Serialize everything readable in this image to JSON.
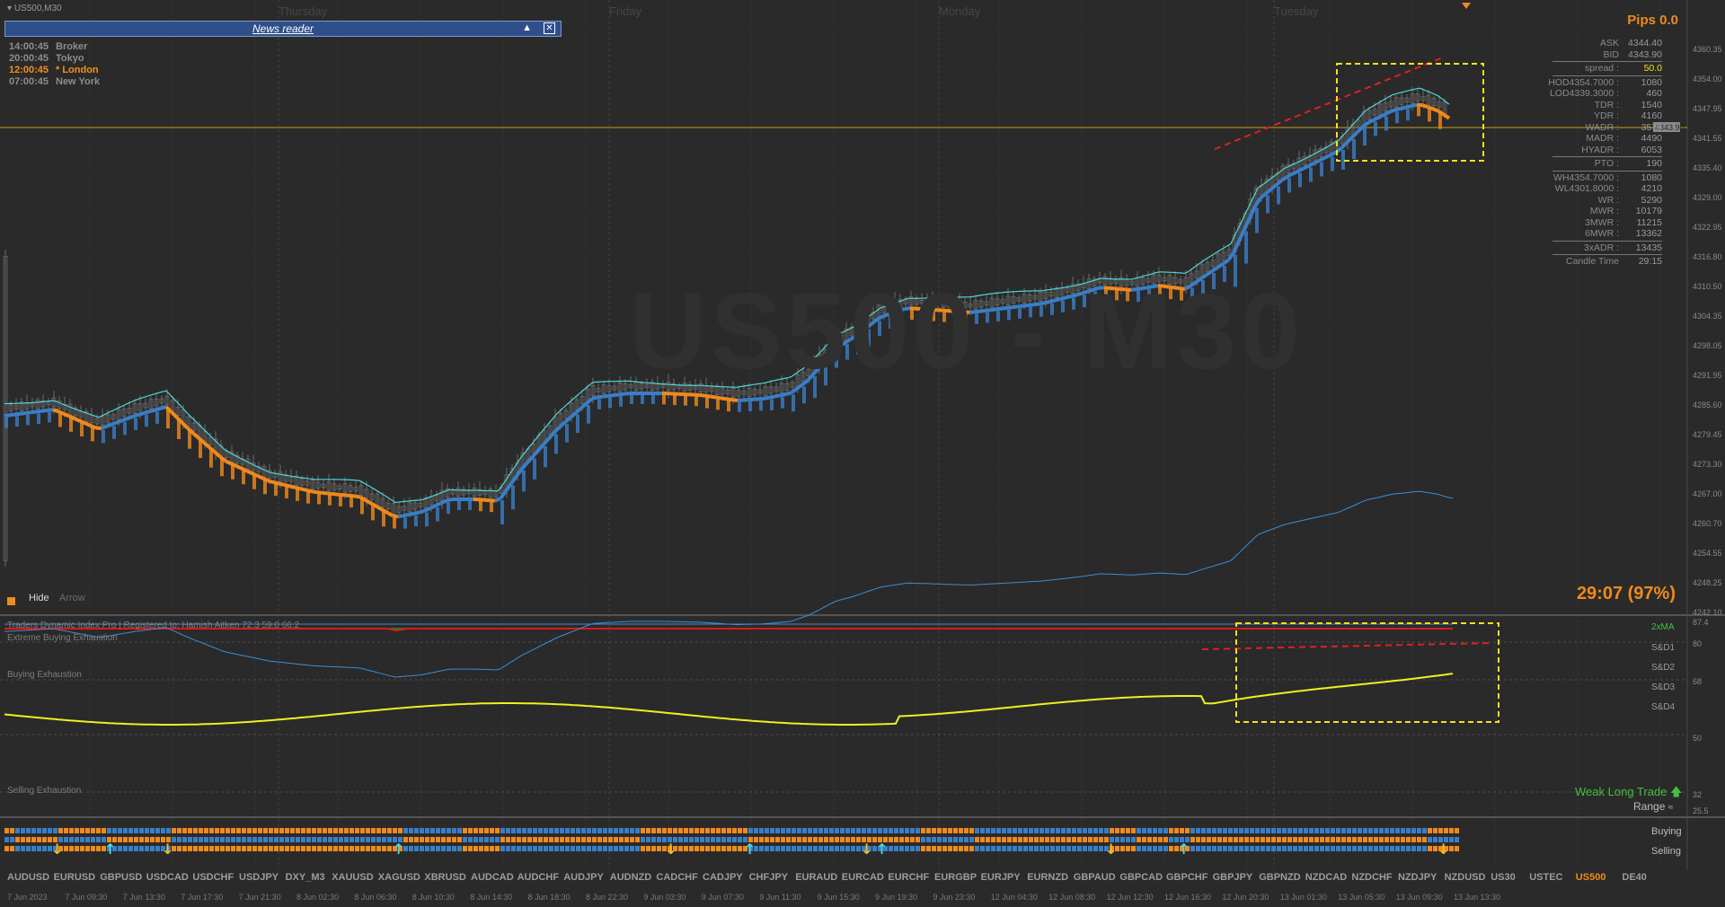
{
  "window": {
    "title": "US500,M30"
  },
  "news_reader": {
    "title": "News reader",
    "collapse_glyph": "▲",
    "close_glyph": "✕"
  },
  "sessions": [
    {
      "time": "14:00:45",
      "name": "Broker",
      "active": false
    },
    {
      "time": "20:00:45",
      "name": "Tokyo",
      "active": false
    },
    {
      "time": "12:00:45",
      "name": "* London",
      "active": true
    },
    {
      "time": "07:00:45",
      "name": "New York",
      "active": false
    }
  ],
  "days": [
    "Thursday",
    "Friday",
    "Monday",
    "Tuesday"
  ],
  "watermark": "US500 - M30",
  "pips": "Pips 0.0",
  "info_panel": [
    {
      "k": "ASK",
      "v": "4344.40"
    },
    {
      "k": "BID",
      "v": "4343.90"
    },
    {
      "sep": true
    },
    {
      "k": "spread :",
      "v": "50.0",
      "hl": true
    },
    {
      "sep": true
    },
    {
      "k": "HOD4354.7000 :",
      "v": "1080"
    },
    {
      "k": "LOD4339.3000 :",
      "v": "460"
    },
    {
      "k": "TDR :",
      "v": "1540"
    },
    {
      "k": "YDR :",
      "v": "4160"
    },
    {
      "k": "WADR :",
      "v": "3576"
    },
    {
      "k": "MADR :",
      "v": "4490"
    },
    {
      "k": "HYADR :",
      "v": "6053"
    },
    {
      "sep": true
    },
    {
      "k": "PTO :",
      "v": "190"
    },
    {
      "sep": true
    },
    {
      "k": "WH4354.7000 :",
      "v": "1080"
    },
    {
      "k": "WL4301.8000 :",
      "v": "4210"
    },
    {
      "k": "WR :",
      "v": "5290"
    },
    {
      "k": "MWR :",
      "v": "10179"
    },
    {
      "k": "3MWR :",
      "v": "11215"
    },
    {
      "k": "6MWR :",
      "v": "13362"
    },
    {
      "sep": true
    },
    {
      "k": "3xADR :",
      "v": "13435"
    },
    {
      "sep": true
    },
    {
      "k": "Candle Time",
      "v": "29:15"
    }
  ],
  "price_axis": [
    "4360.35",
    "4354.00",
    "4347.95",
    "4341.55",
    "4335.40",
    "4329.00",
    "4322.95",
    "4316.80",
    "4310.50",
    "4304.35",
    "4298.05",
    "4291.95",
    "4285.60",
    "4279.45",
    "4273.30",
    "4267.00",
    "4260.70",
    "4254.55",
    "4248.25",
    "4242.10"
  ],
  "current_price": "4343.90",
  "timer": "29:07 (97%)",
  "toggles": {
    "hide": "Hide",
    "arrow": "Arrow"
  },
  "tdi": {
    "title": "Traders Dynamic Index Pro | Registered to: Hamish Aitken 72.3 59.0 66.2",
    "extreme_buying": "Extreme Buying Exhaustion",
    "buying": "Buying Exhaustion",
    "selling": "Selling Exhaustion",
    "levels": [
      "2xMA",
      "S&D1",
      "S&D2",
      "S&D3",
      "S&D4"
    ],
    "axis": [
      "87.4",
      "80",
      "68",
      "50",
      "32",
      "25.5"
    ],
    "signal": "Weak Long Trade",
    "range": "Range",
    "colors": {
      "rsi": "#1a9a1a",
      "signal": "#e01818",
      "ma": "#f0f020",
      "bands": "#3a8fd6"
    }
  },
  "strength": {
    "buying": "Buying",
    "selling": "Selling"
  },
  "symbols": [
    "AUDUSD",
    "EURUSD",
    "GBPUSD",
    "USDCAD",
    "USDCHF",
    "USDJPY",
    "DXY_M3",
    "XAUUSD",
    "XAGUSD",
    "XBRUSD",
    "AUDCAD",
    "AUDCHF",
    "AUDJPY",
    "AUDNZD",
    "CADCHF",
    "CADJPY",
    "CHFJPY",
    "EURAUD",
    "EURCAD",
    "EURCHF",
    "EURGBP",
    "EURJPY",
    "EURNZD",
    "GBPAUD",
    "GBPCAD",
    "GBPCHF",
    "GBPJPY",
    "GBPNZD",
    "NZDCAD",
    "NZDCHF",
    "NZDJPY",
    "NZDUSD",
    "US30",
    "USTEC",
    "US500",
    "DE40"
  ],
  "active_symbol": "US500",
  "dates": [
    "7 Jun 2023",
    "7 Jun 09:30",
    "7 Jun 13:30",
    "7 Jun 17:30",
    "7 Jun 21:30",
    "8 Jun 02:30",
    "8 Jun 06:30",
    "8 Jun 10:30",
    "8 Jun 14:30",
    "8 Jun 18:30",
    "8 Jun 22:30",
    "9 Jun 03:30",
    "9 Jun 07:30",
    "9 Jun 11:30",
    "9 Jun 15:30",
    "9 Jun 19:30",
    "9 Jun 23:30",
    "12 Jun 04:30",
    "12 Jun 08:30",
    "12 Jun 12:30",
    "12 Jun 16:30",
    "12 Jun 20:30",
    "13 Jun 01:30",
    "13 Jun 05:30",
    "13 Jun 09:30",
    "13 Jun 13:30"
  ],
  "colors": {
    "bg": "#2a2a2a",
    "up": "#3a7ec8",
    "down": "#f08a1c",
    "accent": "#f08a1c",
    "box": "#f5e11a",
    "trend": "#e02020"
  }
}
